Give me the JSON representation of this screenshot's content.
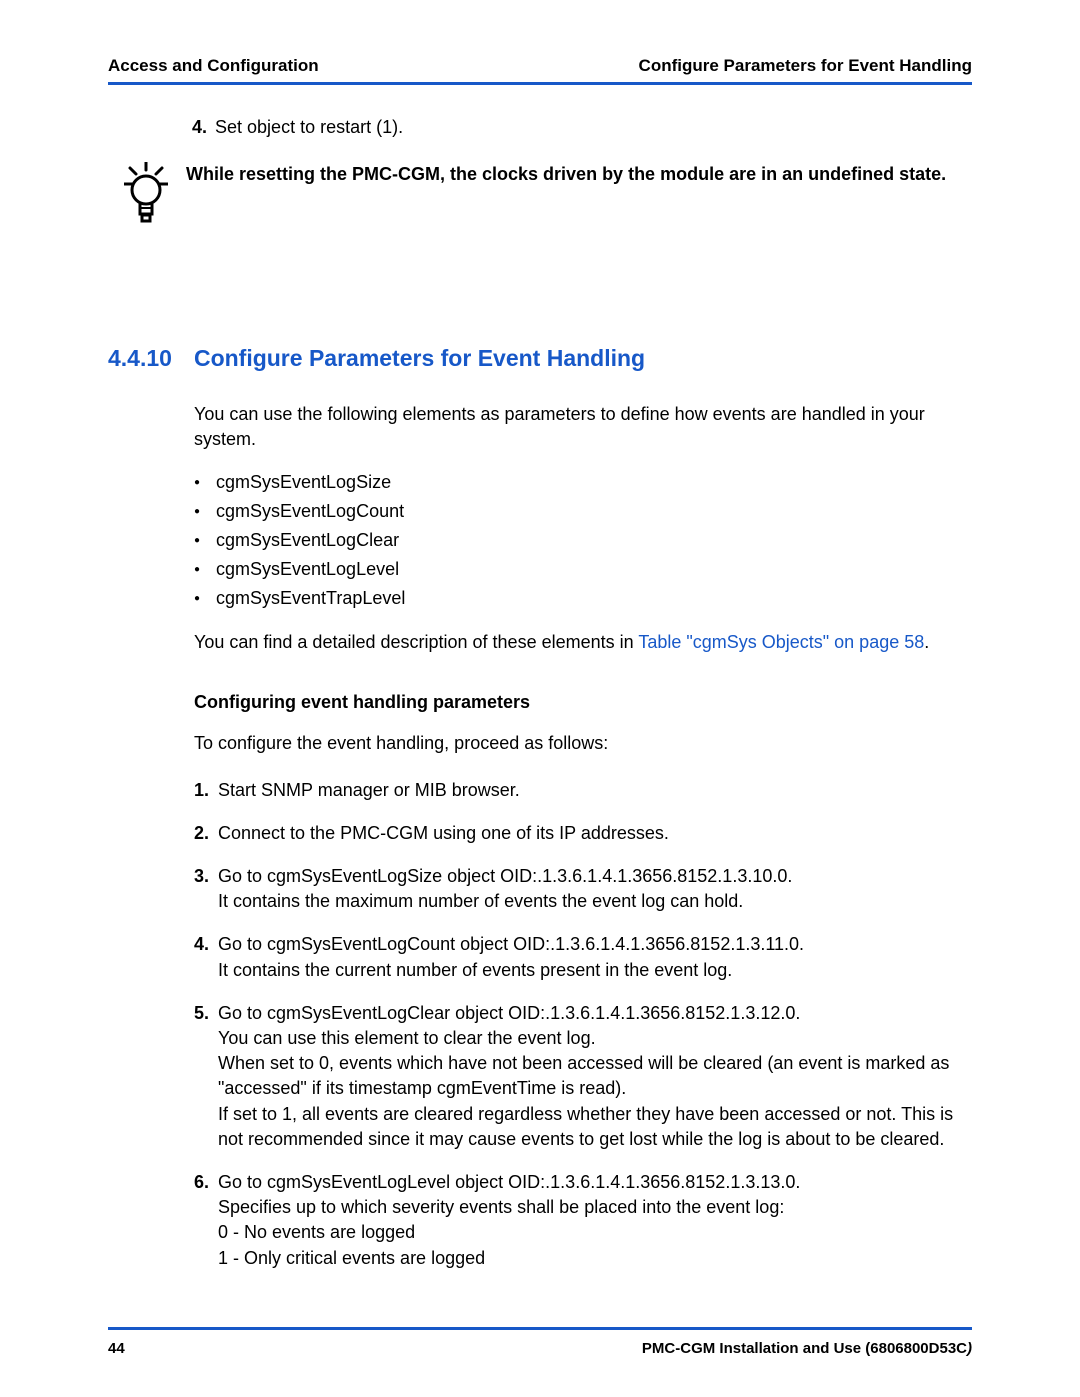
{
  "header": {
    "left": "Access and Configuration",
    "right": "Configure Parameters for Event Handling"
  },
  "priorStep": {
    "number": "4.",
    "text": "Set object to restart (1)."
  },
  "tipNote": "While resetting the PMC-CGM, the clocks driven by the module are in an undefined state.",
  "section": {
    "number": "4.4.10",
    "title": "Configure Parameters for Event Handling",
    "intro": "You can use the following elements as parameters to define how events are handled in your system.",
    "bullets": [
      "cgmSysEventLogSize",
      "cgmSysEventLogCount",
      "cgmSysEventLogClear",
      "cgmSysEventLogLevel",
      "cgmSysEventTrapLevel"
    ],
    "refPrefix": "You can find a detailed description of these elements in ",
    "refLink": "Table \"cgmSys Objects\" on page 58",
    "refSuffix": ".",
    "subhead": "Configuring event handling parameters",
    "subintro": "To configure the event handling, proceed as follows:",
    "steps": [
      "Start SNMP manager or MIB browser.",
      "Connect to the PMC-CGM using one of its IP addresses.",
      "Go to cgmSysEventLogSize object OID:.1.3.6.1.4.1.3656.8152.1.3.10.0.\nIt contains the maximum number of events the event log can hold.",
      "Go to cgmSysEventLogCount object OID:.1.3.6.1.4.1.3656.8152.1.3.11.0.\nIt contains the current number of events present in the event log.",
      "Go to cgmSysEventLogClear object OID:.1.3.6.1.4.1.3656.8152.1.3.12.0.\nYou can use this element to clear the event log.\nWhen set to 0, events which have not been accessed will be cleared (an event is marked as \"accessed\" if its timestamp cgmEventTime is read).\nIf set to 1, all events are cleared regardless whether they have been accessed or not. This is not recommended since it may cause events to get lost while the log is about to be cleared.",
      "Go to cgmSysEventLogLevel object OID:.1.3.6.1.4.1.3656.8152.1.3.13.0.\nSpecifies up to which severity events shall be placed into the event log:\n0 - No events are logged\n1 - Only critical events are logged"
    ]
  },
  "footer": {
    "pageNumber": "44",
    "docTitle": "PMC-CGM Installation and Use (6806800D53C",
    "docTitleTrail": ")"
  }
}
